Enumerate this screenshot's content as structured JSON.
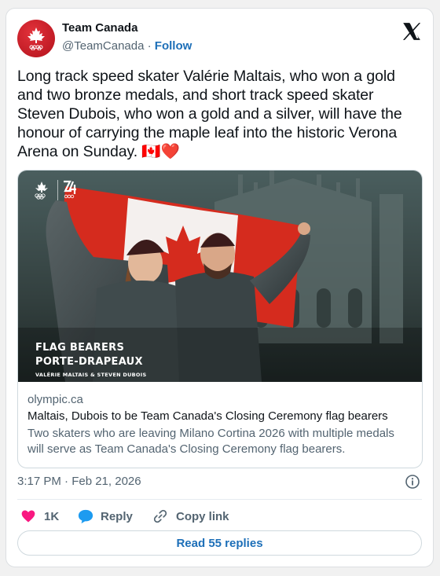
{
  "account": {
    "name": "Team Canada",
    "handle": "@TeamCanada",
    "separator": "·",
    "follow_label": "Follow"
  },
  "tweet": {
    "text": "Long track speed skater Valérie Maltais, who won a gold and two bronze medals, and short track speed skater Steven Dubois, who won a gold and a silver, will have the honour of carrying the maple leaf into the historic Verona Arena on Sunday. 🇨🇦❤️"
  },
  "link_card": {
    "image_overlay": {
      "line1": "FLAG BEARERS",
      "line2": "PORTE-DRAPEAUX",
      "names": "VALÉRIE MALTAIS & STEVEN DUBOIS"
    },
    "domain": "olympic.ca",
    "title": "Maltais, Dubois to be Team Canada's Closing Ceremony flag bearers",
    "description": "Two skaters who are leaving Milano Cortina 2026 with multiple medals will serve as Team Canada's Closing Ceremony flag bearers."
  },
  "meta": {
    "timestamp": "3:17 PM · Feb 21, 2026"
  },
  "actions": {
    "likes": "1K",
    "reply": "Reply",
    "copy_link": "Copy link"
  },
  "read_replies": "Read 55 replies",
  "icons": {
    "platform": "x-logo-icon",
    "like": "heart-icon",
    "reply": "speech-bubble-icon",
    "copy": "link-icon",
    "info": "info-icon"
  },
  "colors": {
    "brand_red": "#d52b1e",
    "link_blue": "#1d6fb8",
    "heart": "#f91880",
    "reply_bubble": "#1d9bf0"
  }
}
